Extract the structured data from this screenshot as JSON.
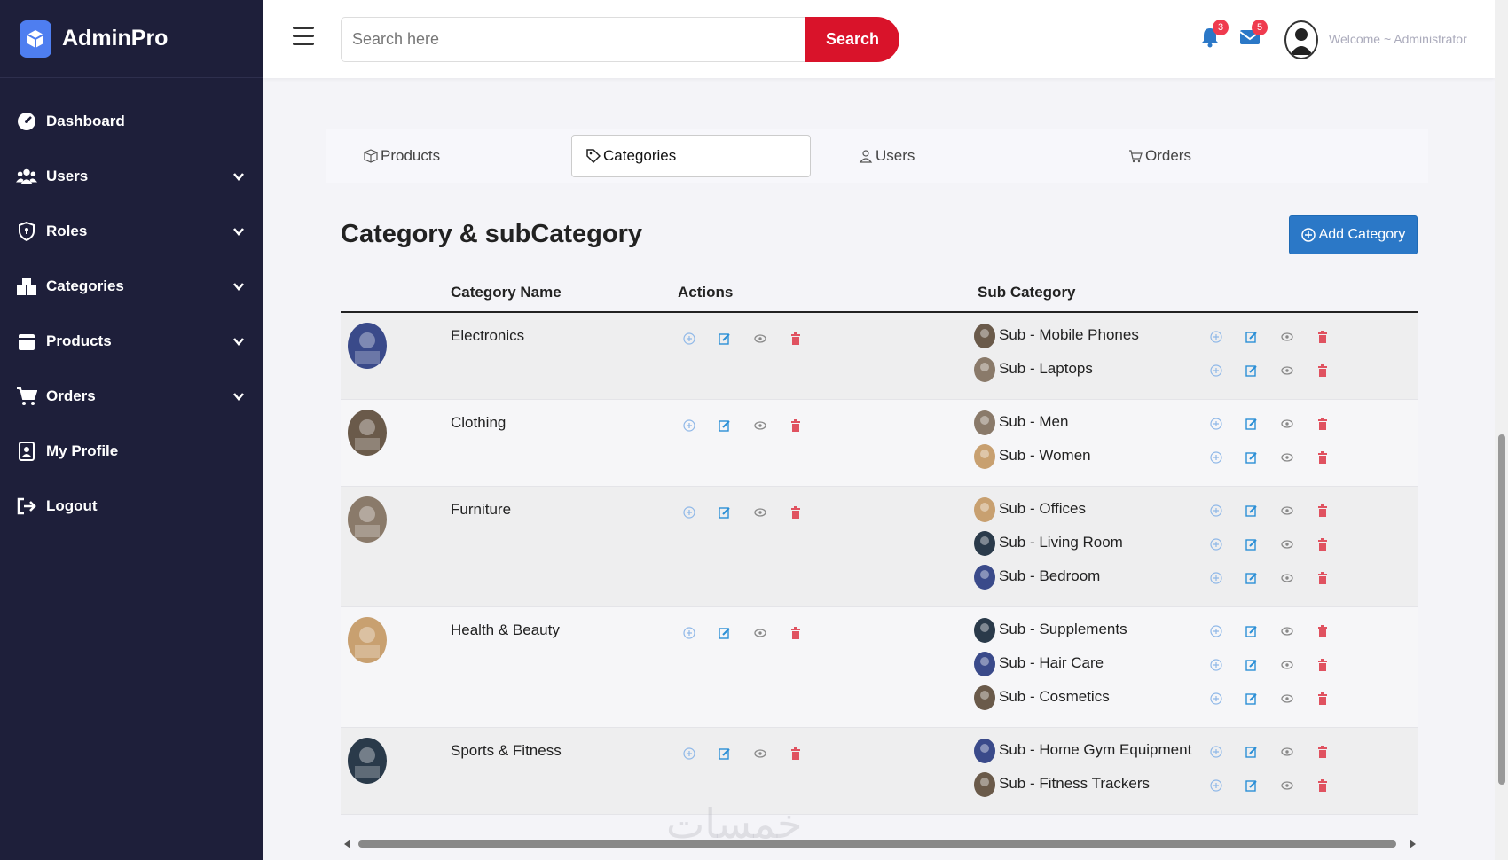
{
  "brand": {
    "name": "AdminPro"
  },
  "sidebar": {
    "items": [
      {
        "label": "Dashboard",
        "icon": "dashboard-icon",
        "has_submenu": false
      },
      {
        "label": "Users",
        "icon": "users-icon",
        "has_submenu": true
      },
      {
        "label": "Roles",
        "icon": "shield-icon",
        "has_submenu": true
      },
      {
        "label": "Categories",
        "icon": "categories-icon",
        "has_submenu": true
      },
      {
        "label": "Products",
        "icon": "box-icon",
        "has_submenu": true
      },
      {
        "label": "Orders",
        "icon": "cart-icon",
        "has_submenu": true
      },
      {
        "label": "My Profile",
        "icon": "id-badge-icon",
        "has_submenu": false
      },
      {
        "label": "Logout",
        "icon": "logout-icon",
        "has_submenu": false
      }
    ]
  },
  "header": {
    "search_placeholder": "Search here",
    "search_button": "Search",
    "notifications_count": "3",
    "messages_count": "5",
    "welcome": "Welcome ~ Administrator"
  },
  "tabs": [
    {
      "label": "Products",
      "icon": "box-icon",
      "active": false
    },
    {
      "label": "Categories",
      "icon": "tag-icon",
      "active": true
    },
    {
      "label": "Users",
      "icon": "user-icon",
      "active": false
    },
    {
      "label": "Orders",
      "icon": "cart-icon",
      "active": false
    }
  ],
  "main": {
    "title": "Category & subCategory",
    "add_button": "Add Category",
    "columns": [
      "Category Name",
      "Actions",
      "Sub Category"
    ],
    "categories": [
      {
        "name": "Electronics",
        "subs": [
          "Sub - Mobile Phones",
          "Sub - Laptops"
        ]
      },
      {
        "name": "Clothing",
        "subs": [
          "Sub - Men",
          "Sub - Women"
        ]
      },
      {
        "name": "Furniture",
        "subs": [
          "Sub - Offices",
          "Sub - Living Room",
          "Sub - Bedroom"
        ]
      },
      {
        "name": "Health & Beauty",
        "subs": [
          "Sub - Supplements",
          "Sub - Hair Care",
          "Sub - Cosmetics"
        ]
      },
      {
        "name": "Sports & Fitness",
        "subs": [
          "Sub - Home Gym Equipment",
          "Sub - Fitness Trackers"
        ]
      }
    ]
  },
  "watermark": "خمسات",
  "colors": {
    "sidebar_bg": "#1e1f3a",
    "search_button": "#d9132a",
    "primary": "#2b78c7",
    "action_add": "#8fb8e8",
    "action_edit": "#2b8fd6",
    "action_view": "#888888",
    "action_delete": "#e05260"
  }
}
